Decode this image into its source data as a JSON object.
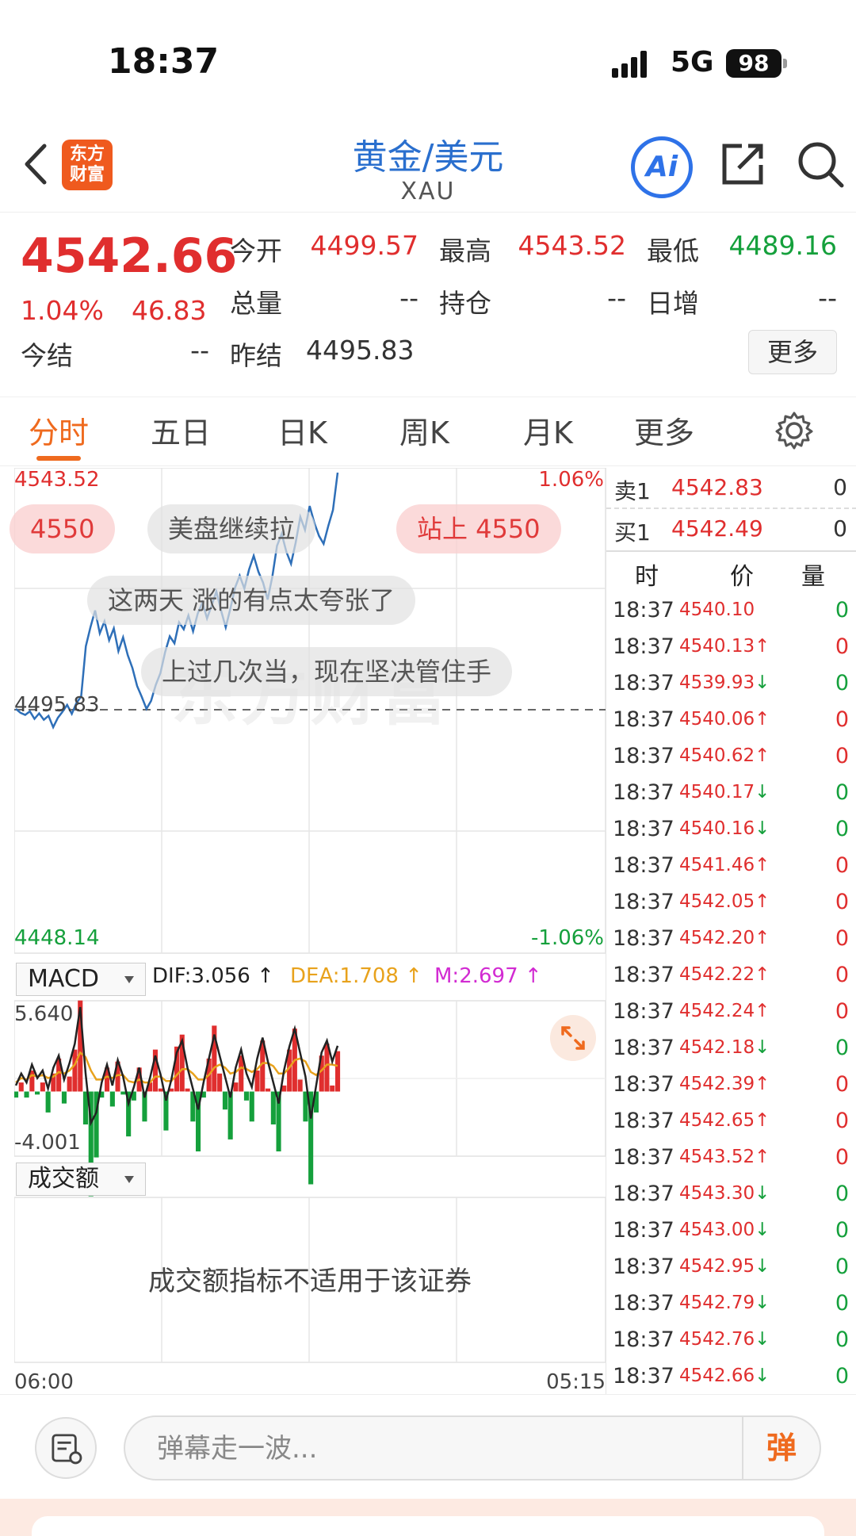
{
  "status_bar": {
    "time": "18:37",
    "network": "5G",
    "battery": "98"
  },
  "nav": {
    "logo_text": "东方财富",
    "title": "黄金/美元",
    "subtitle": "XAU",
    "ai_label": "Ai"
  },
  "quote": {
    "price": "4542.66",
    "change_pct": "1.04%",
    "change": "46.83",
    "fields": [
      {
        "label": "今开",
        "value": "4499.57",
        "color": "red"
      },
      {
        "label": "最高",
        "value": "4543.52",
        "color": "red"
      },
      {
        "label": "最低",
        "value": "4489.16",
        "color": "green"
      },
      {
        "label": "总量",
        "value": "--",
        "color": "gray"
      },
      {
        "label": "持仓",
        "value": "--",
        "color": "gray"
      },
      {
        "label": "日增",
        "value": "--",
        "color": "gray"
      },
      {
        "label": "今结",
        "value": "--",
        "color": "gray"
      },
      {
        "label": "昨结",
        "value": "4495.83",
        "color": "gray"
      }
    ],
    "more_label": "更多"
  },
  "tabs": {
    "items": [
      "分时",
      "五日",
      "日K",
      "周K",
      "月K",
      "更多"
    ],
    "active": 0
  },
  "chart": {
    "y_max_label": "4543.52",
    "y_min_label": "4448.14",
    "pct_max_label": "1.06%",
    "pct_min_label": "-1.06%",
    "ref_label": "4495.83",
    "x_start": "06:00",
    "x_end": "05:15",
    "watermark": "东方财富",
    "danmu": [
      "4550",
      "美盘继续拉",
      "站上 4550",
      "这两天 涨的有点太夸张了",
      "上过几次当，现在坚决管住手"
    ]
  },
  "chart_data": {
    "type": "line",
    "title": "",
    "ylim": [
      4448.14,
      4543.52
    ],
    "reference": 4495.83,
    "xlabel_start": "06:00",
    "xlabel_end": "05:15",
    "series": [
      {
        "values": [
          4496.0,
          4495.2,
          4494.8,
          4495.5,
          4494.0,
          4495.1,
          4493.8,
          4494.6,
          4492.3,
          4494.2,
          4495.4,
          4496.8,
          4495.0,
          4497.2,
          4498.5,
          4508.6,
          4512.4,
          4515.8,
          4511.2,
          4513.6,
          4509.8,
          4512.2,
          4507.6,
          4510.4,
          4506.8,
          4504.2,
          4500.6,
          4498.4,
          4496.0,
          4497.6,
          4500.8,
          4503.2,
          4507.4,
          4510.6,
          4509.2,
          4513.4,
          4512.0,
          4514.8,
          4511.6,
          4515.2,
          4517.4,
          4514.2,
          4516.8,
          4519.6,
          4515.8,
          4512.4,
          4516.2,
          4520.4,
          4522.8,
          4520.2,
          4524.0,
          4526.8,
          4523.6,
          4521.4,
          4518.0,
          4522.6,
          4528.8,
          4531.2,
          4527.6,
          4525.2,
          4529.4,
          4534.6,
          4532.0,
          4536.8,
          4533.4,
          4530.8,
          4529.2,
          4532.8,
          4536.0,
          4543.52
        ]
      }
    ]
  },
  "macd": {
    "indicator_label": "MACD",
    "dif_text": "DIF:3.056 ↑",
    "dea_text": "DEA:1.708 ↑",
    "m_text": "M:2.697 ↑",
    "y_max_label": "5.640",
    "y_min_label": "-4.001",
    "dif": [
      0.4,
      1.2,
      0.6,
      1.8,
      0.9,
      1.4,
      0.2,
      1.6,
      2.4,
      0.8,
      1.9,
      3.2,
      5.64,
      1.2,
      -2.1,
      -1.4,
      0.6,
      1.8,
      0.4,
      2.1,
      1.0,
      -0.8,
      0.3,
      1.6,
      -0.4,
      0.9,
      2.4,
      1.1,
      -0.6,
      0.8,
      2.6,
      3.4,
      1.6,
      0.2,
      -1.2,
      0.6,
      2.2,
      3.8,
      2.4,
      1.0,
      -0.4,
      1.6,
      2.8,
      1.2,
      0.3,
      2.2,
      3.6,
      2.0,
      0.6,
      -0.8,
      1.4,
      3.0,
      4.2,
      2.6,
      1.0,
      -1.8,
      0.4,
      2.6,
      3.4,
      2.0,
      3.056
    ],
    "dea": [
      0.6,
      0.9,
      0.8,
      1.1,
      1.0,
      1.1,
      0.9,
      1.0,
      1.3,
      1.2,
      1.4,
      1.8,
      2.6,
      2.3,
      1.4,
      0.8,
      0.8,
      1.0,
      0.9,
      1.1,
      1.1,
      0.7,
      0.6,
      0.8,
      0.6,
      0.6,
      1.0,
      1.0,
      0.7,
      0.7,
      1.1,
      1.5,
      1.5,
      1.2,
      0.8,
      0.8,
      1.1,
      1.6,
      1.8,
      1.6,
      1.2,
      1.3,
      1.6,
      1.5,
      1.3,
      1.5,
      1.9,
      1.9,
      1.7,
      1.2,
      1.2,
      1.6,
      2.1,
      2.2,
      2.0,
      1.3,
      1.1,
      1.4,
      1.8,
      1.8,
      1.708
    ],
    "colors": {
      "dif": "#222222",
      "dea": "#e8a21c",
      "m": "#d22bd2",
      "up": "#e02e2e",
      "down": "#15a03c"
    }
  },
  "volume": {
    "indicator_label": "成交额",
    "message": "成交额指标不适用于该证券"
  },
  "order_book": [
    {
      "side": "卖1",
      "price": "4542.83",
      "qty": "0"
    },
    {
      "side": "买1",
      "price": "4542.49",
      "qty": "0"
    }
  ],
  "ticks_header": {
    "time": "时",
    "price": "价",
    "volume": "量"
  },
  "ticks": [
    {
      "time": "18:37",
      "price": "4540.10",
      "dir": "",
      "vol": "0",
      "vcolor": "green"
    },
    {
      "time": "18:37",
      "price": "4540.13",
      "dir": "↑",
      "vol": "0",
      "vcolor": "red"
    },
    {
      "time": "18:37",
      "price": "4539.93",
      "dir": "↓",
      "vol": "0",
      "vcolor": "green"
    },
    {
      "time": "18:37",
      "price": "4540.06",
      "dir": "↑",
      "vol": "0",
      "vcolor": "red"
    },
    {
      "time": "18:37",
      "price": "4540.62",
      "dir": "↑",
      "vol": "0",
      "vcolor": "red"
    },
    {
      "time": "18:37",
      "price": "4540.17",
      "dir": "↓",
      "vol": "0",
      "vcolor": "green"
    },
    {
      "time": "18:37",
      "price": "4540.16",
      "dir": "↓",
      "vol": "0",
      "vcolor": "green"
    },
    {
      "time": "18:37",
      "price": "4541.46",
      "dir": "↑",
      "vol": "0",
      "vcolor": "red"
    },
    {
      "time": "18:37",
      "price": "4542.05",
      "dir": "↑",
      "vol": "0",
      "vcolor": "red"
    },
    {
      "time": "18:37",
      "price": "4542.20",
      "dir": "↑",
      "vol": "0",
      "vcolor": "red"
    },
    {
      "time": "18:37",
      "price": "4542.22",
      "dir": "↑",
      "vol": "0",
      "vcolor": "red"
    },
    {
      "time": "18:37",
      "price": "4542.24",
      "dir": "↑",
      "vol": "0",
      "vcolor": "red"
    },
    {
      "time": "18:37",
      "price": "4542.18",
      "dir": "↓",
      "vol": "0",
      "vcolor": "green"
    },
    {
      "time": "18:37",
      "price": "4542.39",
      "dir": "↑",
      "vol": "0",
      "vcolor": "red"
    },
    {
      "time": "18:37",
      "price": "4542.65",
      "dir": "↑",
      "vol": "0",
      "vcolor": "red"
    },
    {
      "time": "18:37",
      "price": "4543.52",
      "dir": "↑",
      "vol": "0",
      "vcolor": "red"
    },
    {
      "time": "18:37",
      "price": "4543.30",
      "dir": "↓",
      "vol": "0",
      "vcolor": "green"
    },
    {
      "time": "18:37",
      "price": "4543.00",
      "dir": "↓",
      "vol": "0",
      "vcolor": "green"
    },
    {
      "time": "18:37",
      "price": "4542.95",
      "dir": "↓",
      "vol": "0",
      "vcolor": "green"
    },
    {
      "time": "18:37",
      "price": "4542.79",
      "dir": "↓",
      "vol": "0",
      "vcolor": "green"
    },
    {
      "time": "18:37",
      "price": "4542.76",
      "dir": "↓",
      "vol": "0",
      "vcolor": "green"
    },
    {
      "time": "18:37",
      "price": "4542.66",
      "dir": "↓",
      "vol": "0",
      "vcolor": "green"
    }
  ],
  "bottom": {
    "input_placeholder": "弹幕走一波...",
    "danmu_button": "弹"
  },
  "theme": {
    "accent": "#ef6a1e",
    "up": "#e02e2e",
    "down": "#15a03c",
    "line": "#2e6fb8",
    "link": "#2a6fce"
  }
}
